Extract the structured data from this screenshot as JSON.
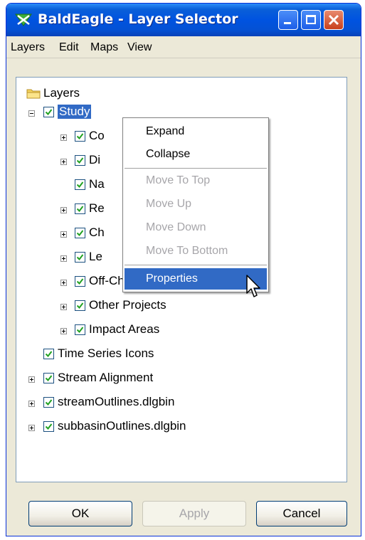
{
  "window": {
    "title": "BaldEagle - Layer Selector",
    "title_icon": "baldeagle-app-icon",
    "controls": [
      "minimize-icon",
      "maximize-icon",
      "close-icon"
    ]
  },
  "menubar": {
    "items": [
      "Layers",
      "Edit",
      "Maps",
      "View"
    ]
  },
  "tree": {
    "root": {
      "label": "Layers",
      "icon": "folder-icon"
    },
    "study": {
      "label": "Study",
      "checked": true,
      "selected": true,
      "expanded": true
    },
    "children": [
      {
        "label": "Co",
        "checked": true,
        "expandable": true
      },
      {
        "label": "Di",
        "checked": true,
        "expandable": true
      },
      {
        "label": "Na",
        "checked": true,
        "expandable": false
      },
      {
        "label": "Re",
        "checked": true,
        "expandable": true
      },
      {
        "label": "Ch",
        "checked": true,
        "expandable": true
      },
      {
        "label": "Le",
        "checked": true,
        "expandable": true
      },
      {
        "label": "Off-Channel Storage",
        "checked": true,
        "expandable": true
      },
      {
        "label": "Other Projects",
        "checked": true,
        "expandable": true
      },
      {
        "label": "Impact Areas",
        "checked": true,
        "expandable": true
      }
    ],
    "top_level": [
      {
        "label": "Time Series Icons",
        "checked": true,
        "expandable": false
      },
      {
        "label": "Stream Alignment",
        "checked": true,
        "expandable": true
      },
      {
        "label": "streamOutlines.dlgbin",
        "checked": true,
        "expandable": true
      },
      {
        "label": "subbasinOutlines.dlgbin",
        "checked": true,
        "expandable": true
      }
    ]
  },
  "context_menu": {
    "items": [
      {
        "label": "Expand",
        "enabled": true
      },
      {
        "label": "Collapse",
        "enabled": true
      },
      {
        "label": "Move To Top",
        "enabled": false
      },
      {
        "label": "Move Up",
        "enabled": false
      },
      {
        "label": "Move Down",
        "enabled": false
      },
      {
        "label": "Move To Bottom",
        "enabled": false
      },
      {
        "label": "Properties",
        "enabled": true,
        "highlighted": true
      }
    ]
  },
  "buttons": {
    "ok": "OK",
    "apply": "Apply",
    "cancel": "Cancel"
  },
  "colors": {
    "titlebar": "#0053e0",
    "selection": "#316ac5",
    "check": "#21a121"
  }
}
